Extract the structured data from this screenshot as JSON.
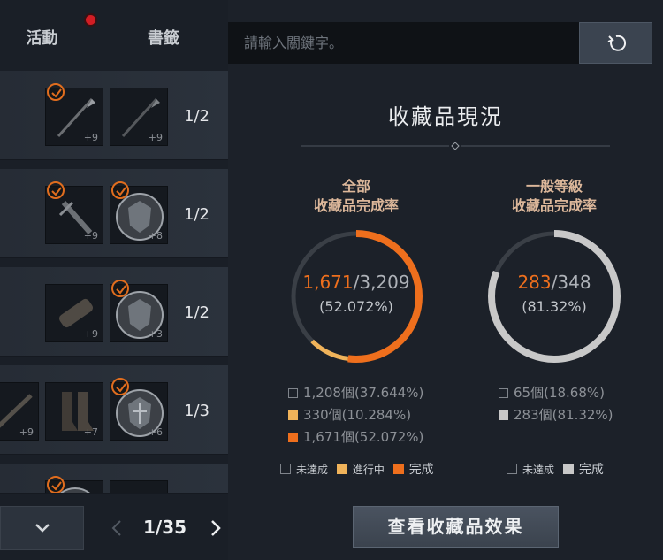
{
  "tabs": {
    "activity": "活動",
    "bookmark": "書籤"
  },
  "search": {
    "placeholder": "請輸入關鍵字。"
  },
  "rows": [
    {
      "count": "1/2",
      "items": [
        {
          "icon": "spear-icon",
          "plus": "+9",
          "checked": true
        },
        {
          "icon": "spear-icon",
          "plus": "+9",
          "checked": false
        }
      ]
    },
    {
      "count": "1/2",
      "items": [
        {
          "icon": "sword-icon",
          "plus": "+9",
          "checked": true
        },
        {
          "icon": "shield-icon",
          "plus": "+8",
          "checked": true
        }
      ]
    },
    {
      "count": "1/2",
      "items": [
        {
          "icon": "bracer-icon",
          "plus": "+9",
          "checked": false
        },
        {
          "icon": "shield-icon",
          "plus": "+3",
          "checked": true
        }
      ]
    },
    {
      "count": "1/3",
      "items": [
        {
          "icon": "blade-icon",
          "plus": "+9",
          "checked": false
        },
        {
          "icon": "greaves-icon",
          "plus": "+7",
          "checked": false
        },
        {
          "icon": "shield-icon",
          "plus": "+6",
          "checked": true
        }
      ]
    }
  ],
  "pager": {
    "current": "1/35"
  },
  "panel": {
    "title": "收藏品現況"
  },
  "stats": {
    "all": {
      "heading_line1": "全部",
      "heading_line2": "收藏品完成率",
      "completed": "1,671",
      "total": "/3,209",
      "percent": "(52.072%)",
      "legend": [
        "1,208個(37.644%)",
        "330個(10.284%)",
        "1,671個(52.072%)"
      ],
      "completed_fraction": 0.52072,
      "in_progress_fraction": 0.10284
    },
    "normal": {
      "heading_line1": "一般等級",
      "heading_line2": "收藏品完成率",
      "completed": "283",
      "total": "/348",
      "percent": "(81.32%)",
      "legend": [
        "65個(18.68%)",
        "283個(81.32%)"
      ],
      "completed_fraction": 0.8132
    }
  },
  "legend_keys": {
    "not_achieved": "未達成",
    "in_progress": "進行中",
    "complete": "完成"
  },
  "colors": {
    "complete": "#ee6f1d",
    "in_progress": "#f0b35a",
    "normal_complete": "#c8c8c8",
    "track": "#3a3f46"
  },
  "effect_button": "查看收藏品效果"
}
